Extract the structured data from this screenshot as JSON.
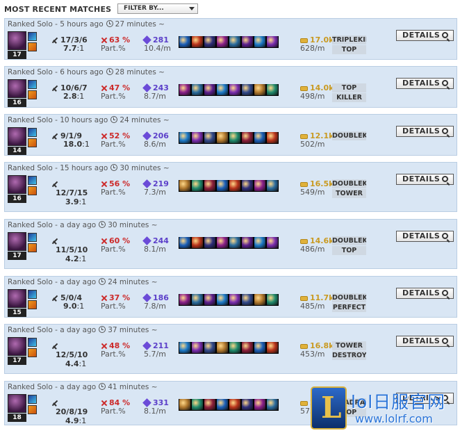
{
  "header": {
    "title": "MOST RECENT MATCHES",
    "filter_label": "FILTER BY..."
  },
  "colors": {
    "row_bg": "#d9e6f4",
    "kill_participation": "#cc2a2a",
    "vision": "#5b3fc9",
    "gold": "#c99a22"
  },
  "icons": {
    "clock": "clock-icon",
    "kda": "crossed-swords-icon",
    "participation": "crossed-swords-red-icon",
    "vision": "ward-icon",
    "gold": "gold-coins-icon",
    "details": "magnifier-plus-icon"
  },
  "matches": [
    {
      "mode": "Ranked Solo",
      "ago": "5 hours ago",
      "duration": "27 minutes ~",
      "level": "17",
      "kda": "17/3/6",
      "ratio": "7.7",
      "ratio_suffix": ":1",
      "participation": "63 %",
      "part_label": "Part.%",
      "vision": "281",
      "vision_rate": "10.4/m",
      "gold": "17.0k",
      "gold_rate": "628/m",
      "badges": [
        "TRIPLEKILL",
        "TOP"
      ],
      "details": "DETAILS"
    },
    {
      "mode": "Ranked Solo",
      "ago": "6 hours ago",
      "duration": "28 minutes ~",
      "level": "16",
      "kda": "10/6/7",
      "ratio": "2.8",
      "ratio_suffix": ":1",
      "participation": "47 %",
      "part_label": "Part.%",
      "vision": "243",
      "vision_rate": "8.7/m",
      "gold": "14.0k",
      "gold_rate": "498/m",
      "badges": [
        "TOP",
        "KILLER"
      ],
      "details": "DETAILS"
    },
    {
      "mode": "Ranked Solo",
      "ago": "10 hours ago",
      "duration": "24 minutes ~",
      "level": "14",
      "kda": "9/1/9",
      "ratio": "18.0",
      "ratio_suffix": ":1",
      "participation": "52 %",
      "part_label": "Part.%",
      "vision": "206",
      "vision_rate": "8.6/m",
      "gold": "12.1k",
      "gold_rate": "502/m",
      "badges": [
        "DOUBLEKILL"
      ],
      "details": "DETAILS"
    },
    {
      "mode": "Ranked Solo",
      "ago": "15 hours ago",
      "duration": "30 minutes ~",
      "level": "16",
      "kda": "12/7/15",
      "ratio": "3.9",
      "ratio_suffix": ":1",
      "participation": "56 %",
      "part_label": "Part.%",
      "vision": "219",
      "vision_rate": "7.3/m",
      "gold": "16.5k",
      "gold_rate": "549/m",
      "badges": [
        "DOUBLEKILL",
        "TOWER"
      ],
      "details": "DETAILS"
    },
    {
      "mode": "Ranked Solo",
      "ago": "a day ago",
      "duration": "30 minutes ~",
      "level": "17",
      "kda": "11/5/10",
      "ratio": "4.2",
      "ratio_suffix": ":1",
      "participation": "60 %",
      "part_label": "Part.%",
      "vision": "244",
      "vision_rate": "8.1/m",
      "gold": "14.6k",
      "gold_rate": "486/m",
      "badges": [
        "DOUBLEKILL",
        "TOP"
      ],
      "details": "DETAILS"
    },
    {
      "mode": "Ranked Solo",
      "ago": "a day ago",
      "duration": "24 minutes ~",
      "level": "15",
      "kda": "5/0/4",
      "ratio": "9.0",
      "ratio_suffix": ":1",
      "participation": "37 %",
      "part_label": "Part.%",
      "vision": "186",
      "vision_rate": "7.8/m",
      "gold": "11.7k",
      "gold_rate": "485/m",
      "badges": [
        "DOUBLEKILL",
        "PERFECT"
      ],
      "details": "DETAILS"
    },
    {
      "mode": "Ranked Solo",
      "ago": "a day ago",
      "duration": "37 minutes ~",
      "level": "17",
      "kda": "12/5/10",
      "ratio": "4.4",
      "ratio_suffix": ":1",
      "participation": "48 %",
      "part_label": "Part.%",
      "vision": "211",
      "vision_rate": "5.7/m",
      "gold": "16.8k",
      "gold_rate": "453/m",
      "badges": [
        "TOWER",
        "DESTROYER"
      ],
      "details": "DETAILS"
    },
    {
      "mode": "Ranked Solo",
      "ago": "a day ago",
      "duration": "41 minutes ~",
      "level": "18",
      "kda": "20/8/19",
      "ratio": "4.9",
      "ratio_suffix": ":1",
      "participation": "84 %",
      "part_label": "Part.%",
      "vision": "331",
      "vision_rate": "8.1/m",
      "gold": "2",
      "gold_rate": "575",
      "badges": [
        "QUADRA",
        "TOP"
      ],
      "details": "DETAILS"
    }
  ],
  "watermark": {
    "logo_letter": "L",
    "title": "lol日服官网",
    "url": "www.lolrf.com"
  }
}
